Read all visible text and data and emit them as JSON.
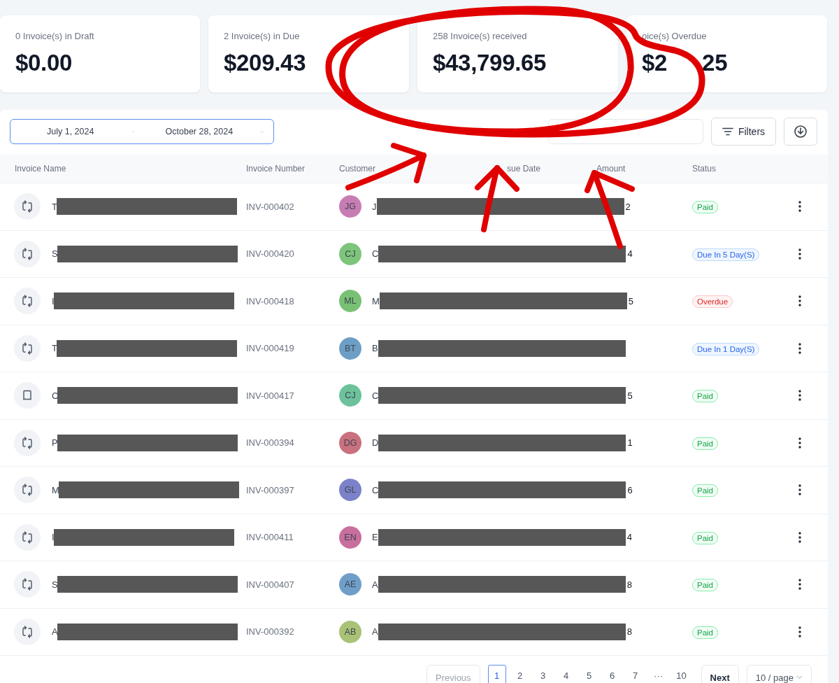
{
  "summary_cards": [
    {
      "label": "0 Invoice(s) in Draft",
      "value": "$0.00"
    },
    {
      "label": "2 Invoice(s) in Due",
      "value": "$209.43"
    },
    {
      "label": "258 Invoice(s) received",
      "value": "$43,799.65"
    },
    {
      "label": "oice(s) Overdue",
      "value": "$2",
      "value_tail": "25"
    }
  ],
  "toolbar": {
    "date_range": {
      "start": "July 1, 2024",
      "end": "October 28, 2024"
    },
    "filters_button": "Filters"
  },
  "table": {
    "columns": [
      "Invoice Name",
      "Invoice Number",
      "Customer",
      "sue Date",
      "Amount",
      "Status"
    ],
    "rows": [
      {
        "kind": "recurring",
        "name": "T",
        "number": "INV-000402",
        "initials": "JG",
        "color": "#c77db3",
        "customer": "J",
        "amount": "2",
        "status": {
          "kind": "paid",
          "label": "Paid"
        }
      },
      {
        "kind": "recurring",
        "name": "S",
        "number": "INV-000420",
        "initials": "CJ",
        "color": "#7ec57b",
        "customer": "C",
        "amount": "4",
        "status": {
          "kind": "due",
          "label": "Due In 5 Day(S)"
        }
      },
      {
        "kind": "recurring",
        "name": "I",
        "number": "INV-000418",
        "initials": "ML",
        "color": "#78c174",
        "customer": "M",
        "amount": "5",
        "status": {
          "kind": "overdue",
          "label": "Overdue"
        }
      },
      {
        "kind": "recurring",
        "name": "T",
        "number": "INV-000419",
        "initials": "BT",
        "color": "#6d9fc6",
        "customer": "B",
        "status": {
          "kind": "due",
          "label": "Due In 1 Day(S)"
        }
      },
      {
        "kind": "receipt",
        "name": "C",
        "number": "INV-000417",
        "initials": "CJ",
        "color": "#6cc29b",
        "customer": "C",
        "amount": "5",
        "status": {
          "kind": "paid",
          "label": "Paid"
        }
      },
      {
        "kind": "recurring",
        "name": "P",
        "number": "INV-000394",
        "initials": "DG",
        "color": "#c9717f",
        "customer": "D",
        "amount": "1",
        "status": {
          "kind": "paid",
          "label": "Paid"
        }
      },
      {
        "kind": "recurring",
        "name": "M",
        "number": "INV-000397",
        "initials": "GL",
        "color": "#7b82c9",
        "customer": "C",
        "amount": "6",
        "status": {
          "kind": "paid",
          "label": "Paid"
        }
      },
      {
        "kind": "recurring",
        "name": "I",
        "number": "INV-000411",
        "initials": "EN",
        "color": "#c86f9f",
        "customer": "E",
        "amount": "4",
        "status": {
          "kind": "paid",
          "label": "Paid"
        }
      },
      {
        "kind": "recurring",
        "name": "S",
        "number": "INV-000407",
        "initials": "AE",
        "color": "#6f9ec8",
        "customer": "A",
        "amount": "8",
        "status": {
          "kind": "paid",
          "label": "Paid"
        }
      },
      {
        "kind": "recurring",
        "name": "A",
        "number": "INV-000392",
        "initials": "AB",
        "color": "#a9c276",
        "customer": "A",
        "amount": "8",
        "status": {
          "kind": "paid",
          "label": "Paid"
        }
      }
    ]
  },
  "pagination": {
    "previous": "Previous",
    "pages": [
      {
        "label": "1",
        "selected": true
      },
      {
        "label": "2",
        "selected": false
      },
      {
        "label": "3",
        "selected": false
      },
      {
        "label": "4",
        "selected": false
      },
      {
        "label": "5",
        "selected": false
      },
      {
        "label": "6",
        "selected": false
      },
      {
        "label": "7",
        "selected": false
      },
      {
        "label": "···",
        "selected": false
      },
      {
        "label": "10",
        "selected": false
      }
    ],
    "next": "Next",
    "page_size": "10 / page"
  }
}
